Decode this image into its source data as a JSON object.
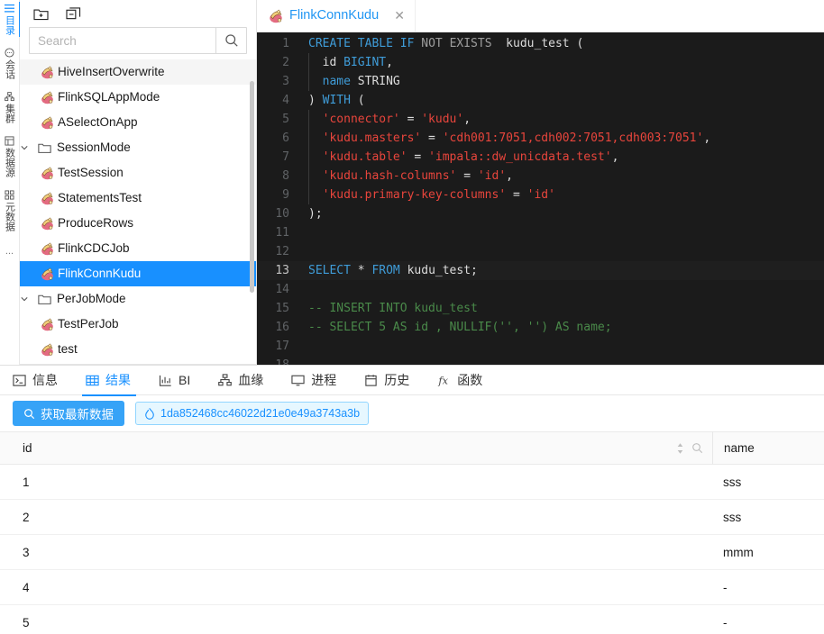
{
  "rail": {
    "items": [
      {
        "label": "目录",
        "icon": "list-icon",
        "active": true
      },
      {
        "label": "会话",
        "icon": "chat-icon",
        "active": false
      },
      {
        "label": "集群",
        "icon": "cluster-icon",
        "active": false
      },
      {
        "label": "数据源",
        "icon": "database-icon",
        "active": false
      },
      {
        "label": "元数据",
        "icon": "metadata-icon",
        "active": false
      }
    ],
    "overflow": "..."
  },
  "sidebar": {
    "toolbar": {
      "new_folder": "new-folder-icon",
      "collapse_all": "collapse-all-icon"
    },
    "search": {
      "value": "",
      "placeholder": "Search",
      "button_icon": "search-icon"
    },
    "tree": [
      {
        "type": "file",
        "label": "HiveInsertOverwrite",
        "indent": 1,
        "state": "hover"
      },
      {
        "type": "file",
        "label": "FlinkSQLAppMode",
        "indent": 1,
        "state": ""
      },
      {
        "type": "file",
        "label": "ASelectOnApp",
        "indent": 1,
        "state": ""
      },
      {
        "type": "folder",
        "label": "SessionMode",
        "indent": 0,
        "state": "",
        "expanded": true
      },
      {
        "type": "file",
        "label": "TestSession",
        "indent": 1,
        "state": ""
      },
      {
        "type": "file",
        "label": "StatementsTest",
        "indent": 1,
        "state": ""
      },
      {
        "type": "file",
        "label": "ProduceRows",
        "indent": 1,
        "state": ""
      },
      {
        "type": "file",
        "label": "FlinkCDCJob",
        "indent": 1,
        "state": ""
      },
      {
        "type": "file",
        "label": "FlinkConnKudu",
        "indent": 1,
        "state": "selected"
      },
      {
        "type": "folder",
        "label": "PerJobMode",
        "indent": 0,
        "state": "",
        "expanded": true
      },
      {
        "type": "file",
        "label": "TestPerJob",
        "indent": 1,
        "state": ""
      },
      {
        "type": "file",
        "label": "test",
        "indent": 1,
        "state": ""
      }
    ]
  },
  "editor": {
    "tabs": [
      {
        "label": "FlinkConnKudu",
        "icon": "flink-file-icon",
        "close": "✕",
        "active": true
      }
    ],
    "active_line": 13,
    "lines": [
      {
        "n": 1,
        "indent": false,
        "tokens": [
          {
            "t": "CREATE",
            "c": "kw"
          },
          {
            "t": " ",
            "c": "plain"
          },
          {
            "t": "TABLE",
            "c": "kw"
          },
          {
            "t": " ",
            "c": "plain"
          },
          {
            "t": "IF",
            "c": "kw"
          },
          {
            "t": " ",
            "c": "plain"
          },
          {
            "t": "NOT",
            "c": "kw2"
          },
          {
            "t": " ",
            "c": "plain"
          },
          {
            "t": "EXISTS",
            "c": "kw2"
          },
          {
            "t": "  kudu_test (",
            "c": "plain"
          }
        ]
      },
      {
        "n": 2,
        "indent": true,
        "tokens": [
          {
            "t": "  id ",
            "c": "plain"
          },
          {
            "t": "BIGINT",
            "c": "typ"
          },
          {
            "t": ",",
            "c": "plain"
          }
        ]
      },
      {
        "n": 3,
        "indent": true,
        "tokens": [
          {
            "t": "  ",
            "c": "plain"
          },
          {
            "t": "name",
            "c": "typ"
          },
          {
            "t": " STRING",
            "c": "plain"
          }
        ]
      },
      {
        "n": 4,
        "indent": false,
        "tokens": [
          {
            "t": ") ",
            "c": "plain"
          },
          {
            "t": "WITH",
            "c": "kw"
          },
          {
            "t": " (",
            "c": "plain"
          }
        ]
      },
      {
        "n": 5,
        "indent": true,
        "tokens": [
          {
            "t": "  ",
            "c": "plain"
          },
          {
            "t": "'connector'",
            "c": "str"
          },
          {
            "t": " = ",
            "c": "plain"
          },
          {
            "t": "'kudu'",
            "c": "str"
          },
          {
            "t": ",",
            "c": "plain"
          }
        ]
      },
      {
        "n": 6,
        "indent": true,
        "tokens": [
          {
            "t": "  ",
            "c": "plain"
          },
          {
            "t": "'kudu.masters'",
            "c": "str"
          },
          {
            "t": " = ",
            "c": "plain"
          },
          {
            "t": "'cdh001:7051,cdh002:7051,cdh003:7051'",
            "c": "str"
          },
          {
            "t": ",",
            "c": "plain"
          }
        ]
      },
      {
        "n": 7,
        "indent": true,
        "tokens": [
          {
            "t": "  ",
            "c": "plain"
          },
          {
            "t": "'kudu.table'",
            "c": "str"
          },
          {
            "t": " = ",
            "c": "plain"
          },
          {
            "t": "'impala::dw_unicdata.test'",
            "c": "str"
          },
          {
            "t": ",",
            "c": "plain"
          }
        ]
      },
      {
        "n": 8,
        "indent": true,
        "tokens": [
          {
            "t": "  ",
            "c": "plain"
          },
          {
            "t": "'kudu.hash-columns'",
            "c": "str"
          },
          {
            "t": " = ",
            "c": "plain"
          },
          {
            "t": "'id'",
            "c": "str"
          },
          {
            "t": ",",
            "c": "plain"
          }
        ]
      },
      {
        "n": 9,
        "indent": true,
        "tokens": [
          {
            "t": "  ",
            "c": "plain"
          },
          {
            "t": "'kudu.primary-key-columns'",
            "c": "str"
          },
          {
            "t": " = ",
            "c": "plain"
          },
          {
            "t": "'id'",
            "c": "str"
          }
        ]
      },
      {
        "n": 10,
        "indent": false,
        "tokens": [
          {
            "t": ");",
            "c": "plain"
          }
        ]
      },
      {
        "n": 11,
        "indent": false,
        "tokens": [
          {
            "t": "",
            "c": "plain"
          }
        ]
      },
      {
        "n": 12,
        "indent": false,
        "tokens": [
          {
            "t": "",
            "c": "plain"
          }
        ]
      },
      {
        "n": 13,
        "indent": false,
        "tokens": [
          {
            "t": "SELECT",
            "c": "kw"
          },
          {
            "t": " ",
            "c": "plain"
          },
          {
            "t": "*",
            "c": "op"
          },
          {
            "t": " ",
            "c": "plain"
          },
          {
            "t": "FROM",
            "c": "kw"
          },
          {
            "t": " kudu_test;",
            "c": "plain"
          }
        ]
      },
      {
        "n": 14,
        "indent": false,
        "tokens": [
          {
            "t": "",
            "c": "plain"
          }
        ]
      },
      {
        "n": 15,
        "indent": false,
        "tokens": [
          {
            "t": "-- INSERT INTO kudu_test",
            "c": "cmt"
          }
        ]
      },
      {
        "n": 16,
        "indent": false,
        "tokens": [
          {
            "t": "-- SELECT 5 AS id , NULLIF('', '') AS name;",
            "c": "cmt"
          }
        ]
      },
      {
        "n": 17,
        "indent": false,
        "tokens": [
          {
            "t": "",
            "c": "plain"
          }
        ]
      },
      {
        "n": 18,
        "indent": false,
        "tokens": [
          {
            "t": "",
            "c": "plain"
          }
        ]
      }
    ]
  },
  "bottom_panel": {
    "tabs": [
      {
        "label": "信息",
        "icon": "console-icon",
        "active": false
      },
      {
        "label": "结果",
        "icon": "table-icon",
        "active": true
      },
      {
        "label": "BI",
        "icon": "chart-icon",
        "active": false
      },
      {
        "label": "血缘",
        "icon": "lineage-icon",
        "active": false
      },
      {
        "label": "进程",
        "icon": "monitor-icon",
        "active": false
      },
      {
        "label": "历史",
        "icon": "calendar-icon",
        "active": false
      },
      {
        "label": "函数",
        "icon": "function-icon",
        "active": false
      }
    ],
    "toolbar": {
      "refresh_button": {
        "label": "获取最新数据",
        "icon": "search-icon"
      },
      "job_chip": {
        "label": "1da852468cc46022d21e0e49a3743a3b",
        "icon": "flame-icon"
      }
    },
    "result_table": {
      "columns": [
        "id",
        "name"
      ],
      "header_icons": [
        "sort-icon",
        "search-icon"
      ],
      "rows": [
        {
          "id": "1",
          "name": "sss"
        },
        {
          "id": "2",
          "name": "sss"
        },
        {
          "id": "3",
          "name": "mmm"
        },
        {
          "id": "4",
          "name": "-"
        },
        {
          "id": "5",
          "name": "-"
        }
      ]
    }
  },
  "colors": {
    "accent": "#1890ff",
    "selected_row": "#1890ff",
    "editor_bg": "#1b1b1b",
    "button": "#36a3f7"
  }
}
